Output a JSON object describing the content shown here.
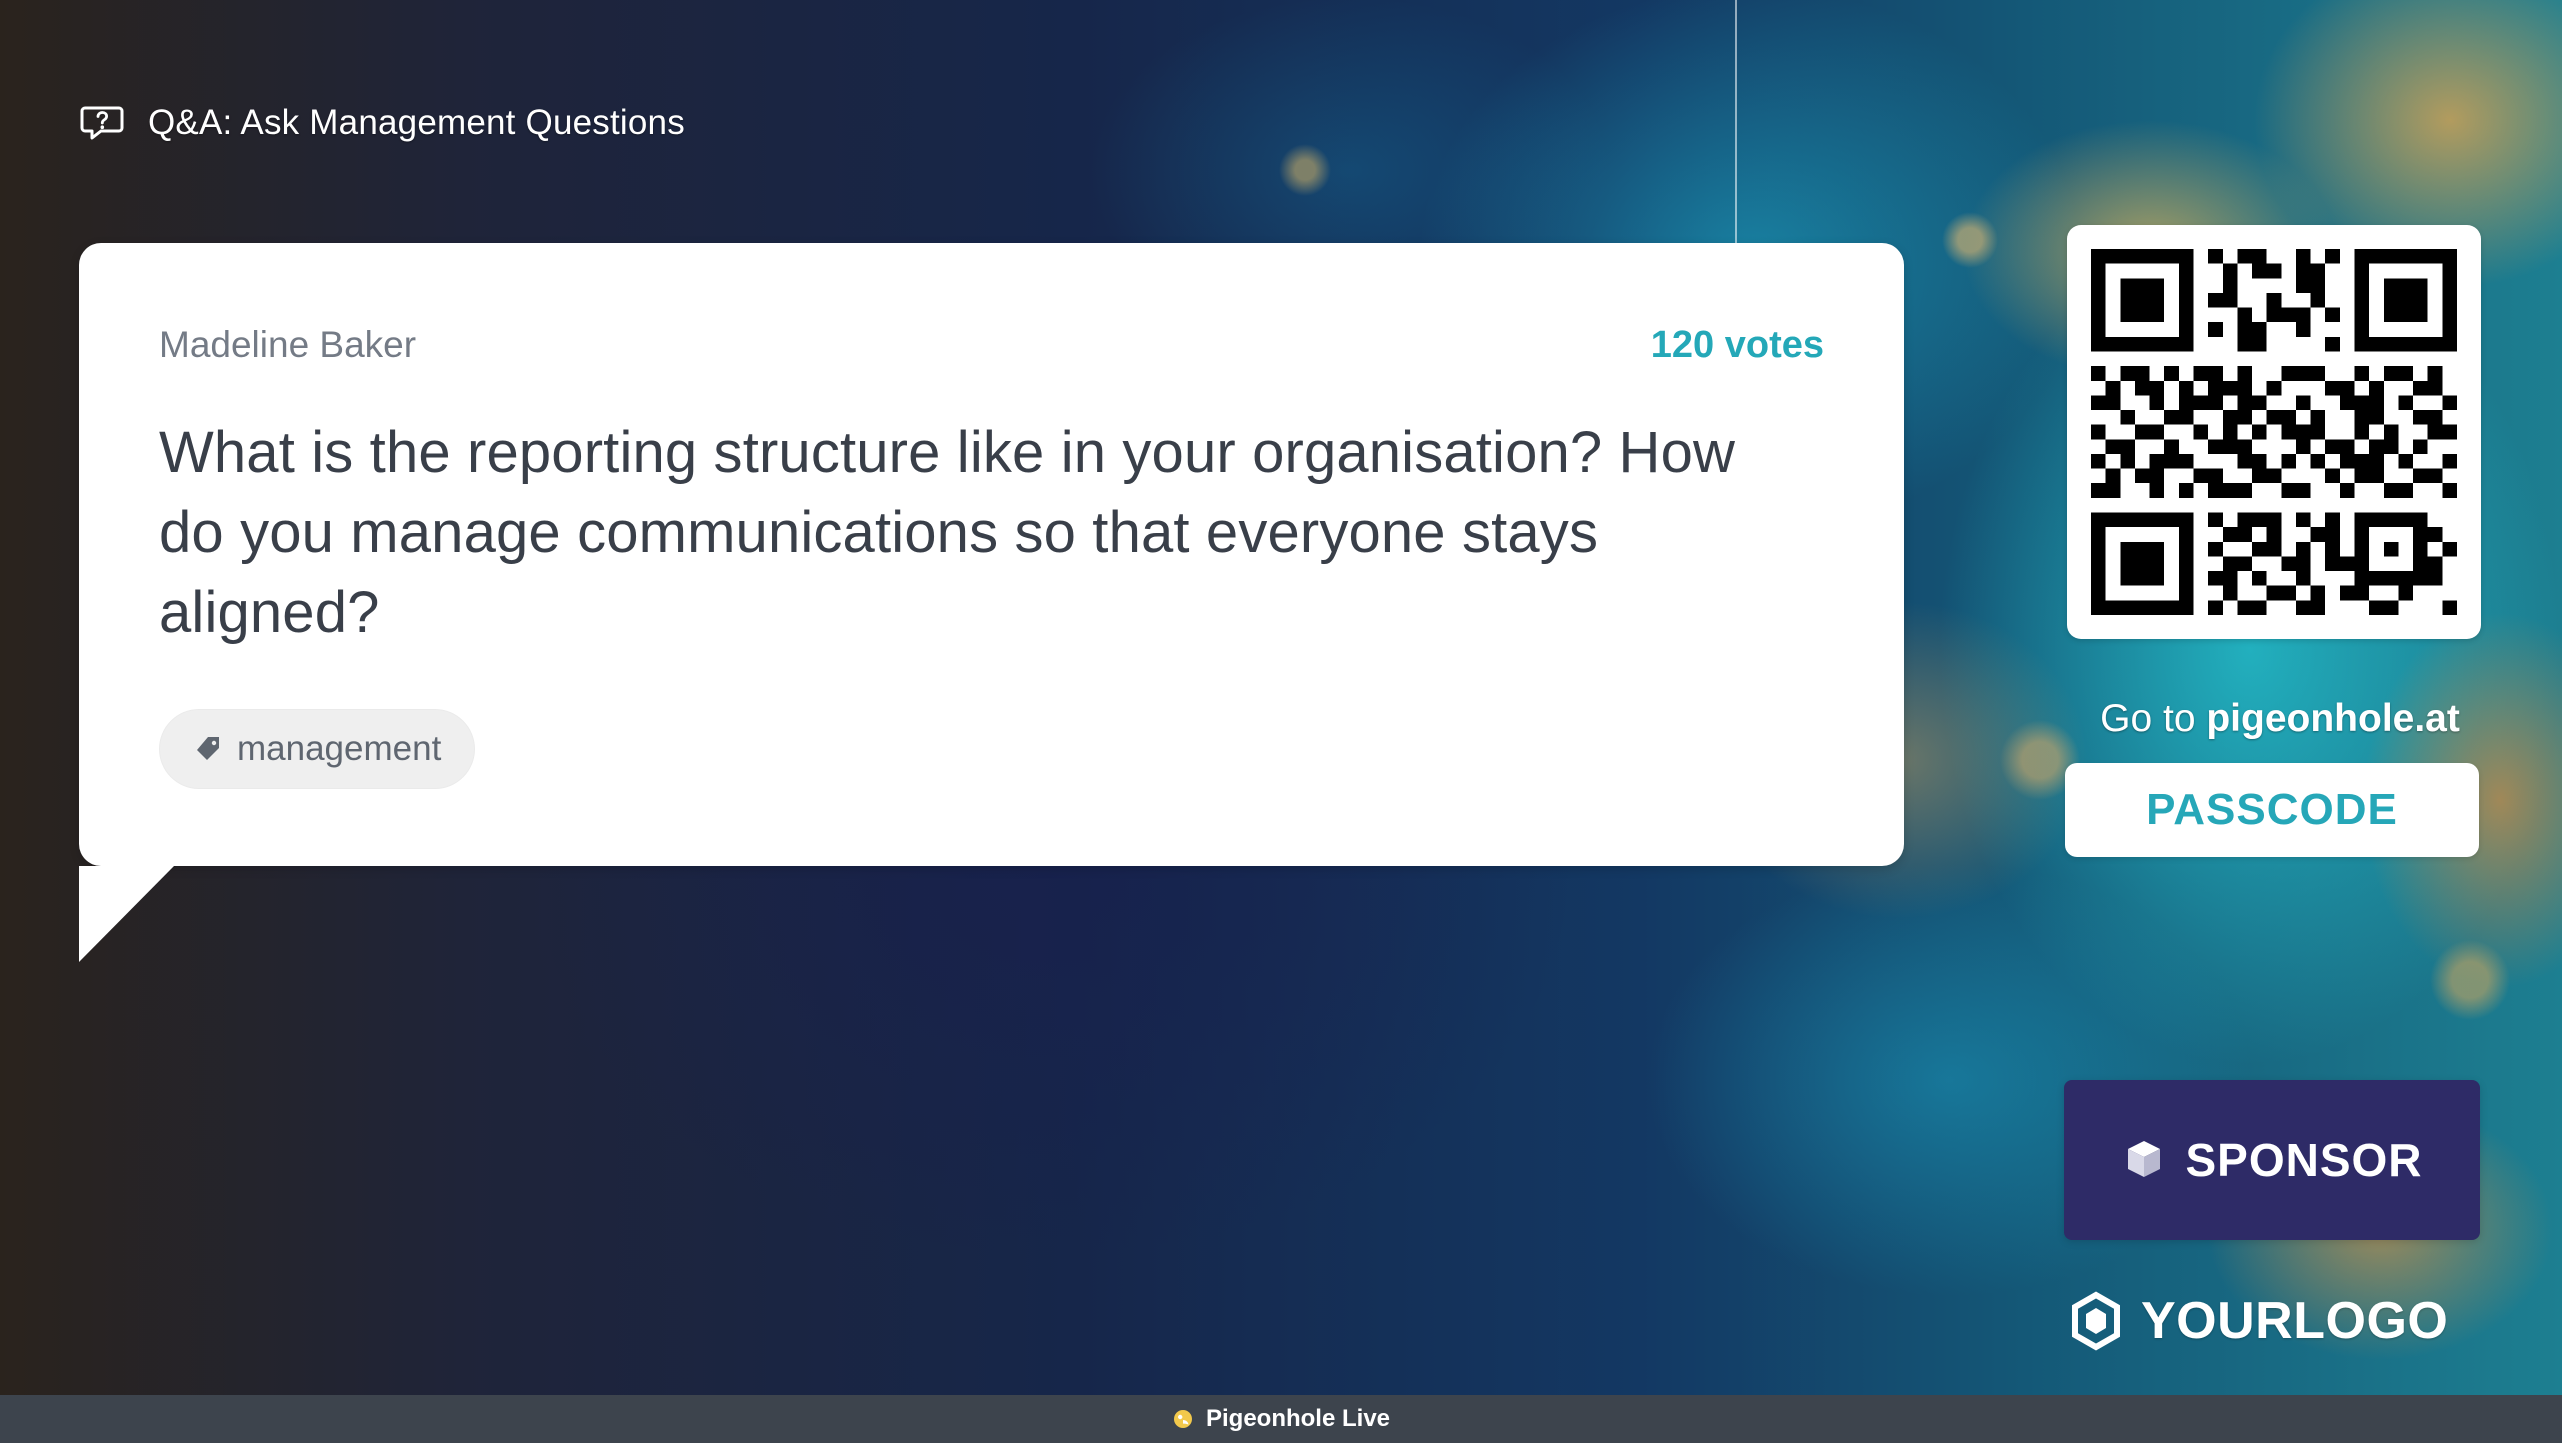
{
  "header": {
    "title": "Q&A: Ask Management Questions",
    "icon": "speech-bubble-question-icon"
  },
  "question_card": {
    "author": "Madeline Baker",
    "votes": "120 votes",
    "question": "What is the reporting structure like in your organisation? How do you manage communications so that everyone stays aligned?",
    "tag": {
      "icon": "tag-icon",
      "label": "management"
    }
  },
  "join_panel": {
    "go_to_prefix": "Go to",
    "domain": "pigeonhole.at",
    "passcode": "PASSCODE",
    "qr_icon": "qr-code-icon"
  },
  "sponsor": {
    "icon": "box-icon",
    "label": "SPONSOR"
  },
  "logo": {
    "icon": "hexagon-logo-icon",
    "text": "YOURLOGO"
  },
  "footer": {
    "icon": "pigeonhole-icon",
    "label": "Pigeonhole Live"
  },
  "colors": {
    "accent": "#24a8b8",
    "sponsor_bg": "#2e2b67",
    "footer_bg": "#3d444d"
  }
}
